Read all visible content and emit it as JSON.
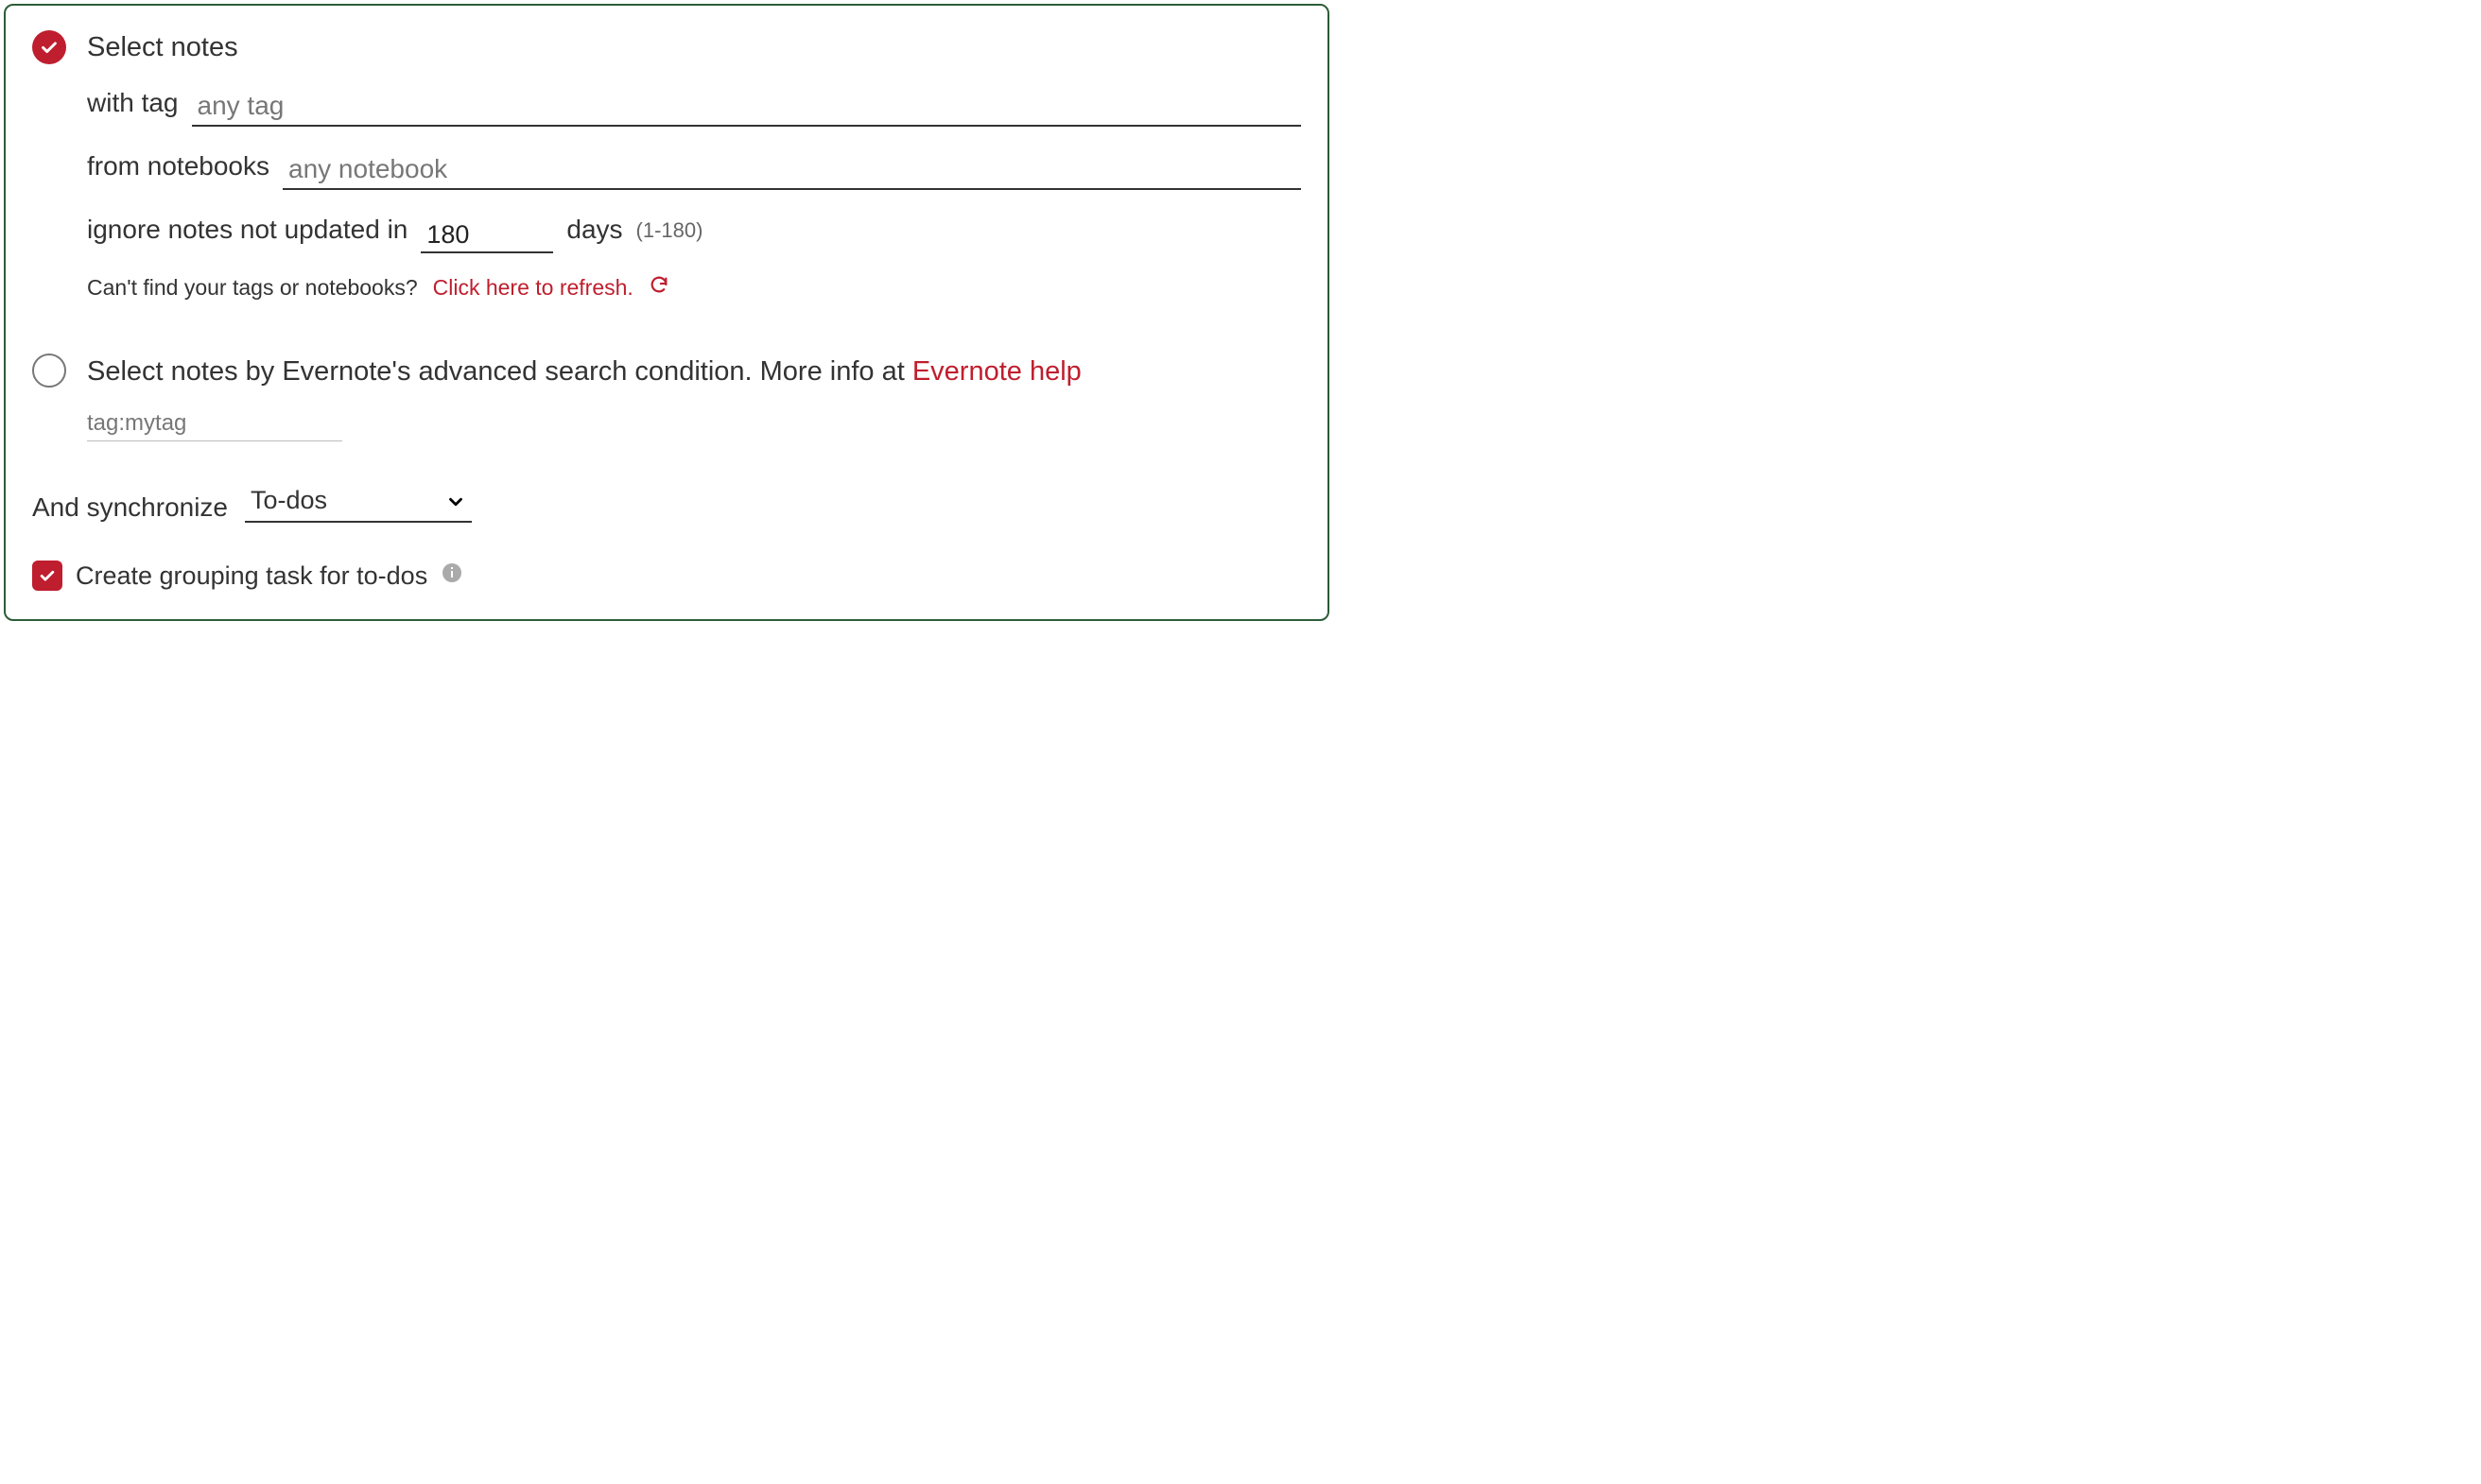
{
  "option1": {
    "title": "Select notes",
    "tag": {
      "label": "with tag",
      "placeholder": "any tag",
      "value": ""
    },
    "notebooks": {
      "label": "from notebooks",
      "placeholder": "any notebook",
      "value": ""
    },
    "staleness": {
      "label": "ignore notes not updated in",
      "value": "180",
      "suffix": "days",
      "range_hint": "(1-180)"
    },
    "refresh": {
      "question": "Can't find your tags or notebooks?",
      "link_text": "Click here to refresh."
    }
  },
  "option2": {
    "text_prefix": "Select notes by Evernote's advanced search condition. More info at ",
    "link_text": "Evernote help",
    "search_placeholder": "tag:mytag",
    "search_value": ""
  },
  "sync": {
    "label": "And synchronize",
    "selected": "To-dos"
  },
  "grouping": {
    "label": "Create grouping task for to-dos",
    "checked": true
  }
}
